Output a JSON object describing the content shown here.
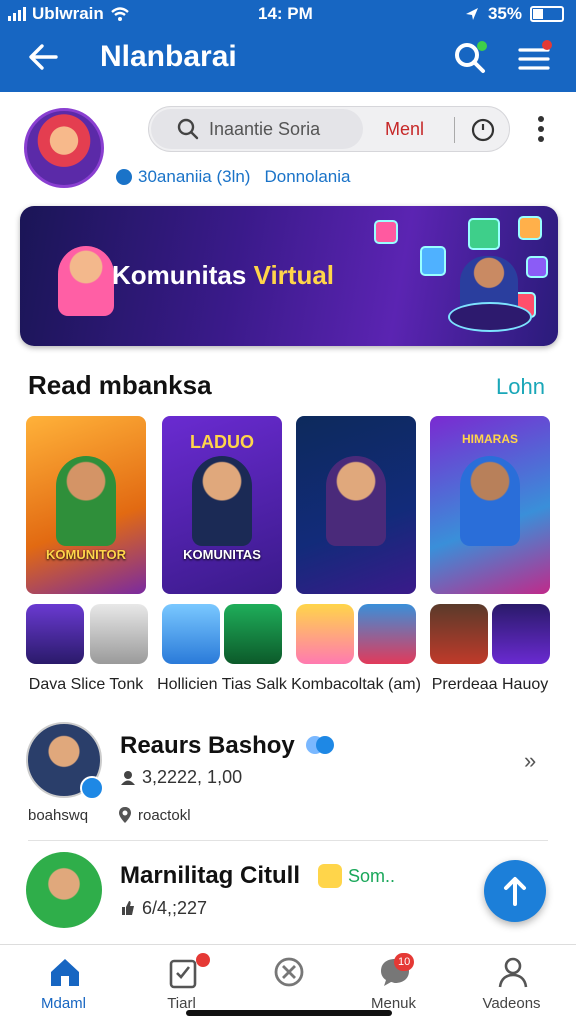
{
  "status": {
    "carrier": "Ublwrain",
    "time": "14: PM",
    "battery": "35%"
  },
  "header": {
    "title": "Nlanbarai"
  },
  "profile": {
    "search_placeholder": "Inaantie Soria",
    "menu_label": "Menl",
    "meta_followers": "30ananiia (3ln)",
    "meta_link": "Donnolania"
  },
  "banner": {
    "text_a": "Komunitas ",
    "text_b": "Virtual"
  },
  "section": {
    "title": "Read mbanksa",
    "link": "Lohn"
  },
  "cards": [
    {
      "top": "",
      "caption": "KOMUNITOR"
    },
    {
      "top": "LADUO",
      "caption": "KOMUNITAS"
    },
    {
      "top": "",
      "caption": ""
    },
    {
      "top": "HIMARAS",
      "caption": ""
    }
  ],
  "mini_labels": [
    "Dava Slice Tonk",
    "Hollicien Tias Salk",
    "Kombacoltak (am)",
    "Prerdeaa Hauoy"
  ],
  "list": [
    {
      "name": "Reaurs Bashoy",
      "stat": "3,2222, 1,00",
      "tag1": "boahswq",
      "tag2": "roactokl"
    },
    {
      "name": "Marnilitag Citull",
      "badge": "Som..",
      "stat": "6/4,;227"
    }
  ],
  "nav": [
    {
      "label": "Mdaml",
      "icon": "home-icon",
      "badge": ""
    },
    {
      "label": "Tiarl",
      "icon": "clipboard-icon",
      "badge": ""
    },
    {
      "label": "",
      "icon": "cancel-circle-icon",
      "badge": ""
    },
    {
      "label": "Menuk",
      "icon": "chat-icon",
      "badge": "10"
    },
    {
      "label": "Vadeons",
      "icon": "person-icon",
      "badge": ""
    }
  ],
  "colors": {
    "brand": "#1766c2",
    "accent_link": "#1aa7b8",
    "badge": "#e53935"
  }
}
